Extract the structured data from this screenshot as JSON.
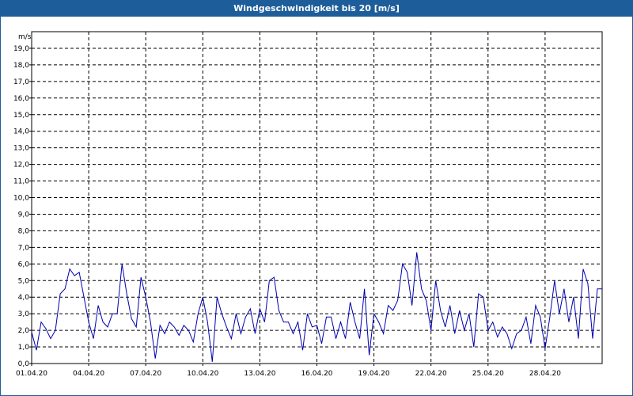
{
  "window": {
    "title": "Windgeschwindigkeit bis 20 [m/s]"
  },
  "chart_data": {
    "type": "line",
    "title": "Windgeschwindigkeit bis 20 [m/s]",
    "ylabel": "m/s",
    "xlabel": "",
    "ylim": [
      0,
      20
    ],
    "xlim": [
      "2020-04-01",
      "2020-05-01"
    ],
    "grid": true,
    "line_color": "#0000b0",
    "y_ticks": [
      "0,0",
      "1,0",
      "2,0",
      "3,0",
      "4,0",
      "5,0",
      "6,0",
      "7,0",
      "8,0",
      "9,0",
      "10,0",
      "11,0",
      "12,0",
      "13,0",
      "14,0",
      "15,0",
      "16,0",
      "17,0",
      "18,0",
      "19,0"
    ],
    "x_ticks": [
      "01.04.20",
      "04.04.20",
      "07.04.20",
      "10.04.20",
      "13.04.20",
      "16.04.20",
      "19.04.20",
      "22.04.20",
      "25.04.20",
      "28.04.20"
    ],
    "series": [
      {
        "x": [
          "2020-04-01T00:00",
          "2020-04-01T06:00",
          "2020-04-01T12:00",
          "2020-04-01T18:00",
          "2020-04-02T00:00",
          "2020-04-02T06:00",
          "2020-04-02T12:00",
          "2020-04-02T18:00",
          "2020-04-03T00:00",
          "2020-04-03T06:00",
          "2020-04-03T12:00",
          "2020-04-03T18:00",
          "2020-04-04T00:00",
          "2020-04-04T06:00",
          "2020-04-04T12:00",
          "2020-04-04T18:00",
          "2020-04-05T00:00",
          "2020-04-05T06:00",
          "2020-04-05T12:00",
          "2020-04-05T18:00",
          "2020-04-06T00:00",
          "2020-04-06T06:00",
          "2020-04-06T12:00",
          "2020-04-06T18:00",
          "2020-04-07T00:00",
          "2020-04-07T06:00",
          "2020-04-07T12:00",
          "2020-04-07T18:00",
          "2020-04-08T00:00",
          "2020-04-08T06:00",
          "2020-04-08T12:00",
          "2020-04-08T18:00",
          "2020-04-09T00:00",
          "2020-04-09T06:00",
          "2020-04-09T12:00",
          "2020-04-09T18:00",
          "2020-04-10T00:00",
          "2020-04-10T06:00",
          "2020-04-10T12:00",
          "2020-04-10T18:00",
          "2020-04-11T00:00",
          "2020-04-11T06:00",
          "2020-04-11T12:00",
          "2020-04-11T18:00",
          "2020-04-12T00:00",
          "2020-04-12T06:00",
          "2020-04-12T12:00",
          "2020-04-12T18:00",
          "2020-04-13T00:00",
          "2020-04-13T06:00",
          "2020-04-13T12:00",
          "2020-04-13T18:00",
          "2020-04-14T00:00",
          "2020-04-14T06:00",
          "2020-04-14T12:00",
          "2020-04-14T18:00",
          "2020-04-15T00:00",
          "2020-04-15T06:00",
          "2020-04-15T12:00",
          "2020-04-15T18:00",
          "2020-04-16T00:00",
          "2020-04-16T06:00",
          "2020-04-16T12:00",
          "2020-04-16T18:00",
          "2020-04-17T00:00",
          "2020-04-17T06:00",
          "2020-04-17T12:00",
          "2020-04-17T18:00",
          "2020-04-18T00:00",
          "2020-04-18T06:00",
          "2020-04-18T12:00",
          "2020-04-18T18:00",
          "2020-04-19T00:00",
          "2020-04-19T06:00",
          "2020-04-19T12:00",
          "2020-04-19T18:00",
          "2020-04-20T00:00",
          "2020-04-20T06:00",
          "2020-04-20T12:00",
          "2020-04-20T18:00",
          "2020-04-21T00:00",
          "2020-04-21T06:00",
          "2020-04-21T12:00",
          "2020-04-21T18:00",
          "2020-04-22T00:00",
          "2020-04-22T06:00",
          "2020-04-22T12:00",
          "2020-04-22T18:00",
          "2020-04-23T00:00",
          "2020-04-23T06:00",
          "2020-04-23T12:00",
          "2020-04-23T18:00",
          "2020-04-24T00:00",
          "2020-04-24T06:00",
          "2020-04-24T12:00",
          "2020-04-24T18:00",
          "2020-04-25T00:00",
          "2020-04-25T06:00",
          "2020-04-25T12:00",
          "2020-04-25T18:00",
          "2020-04-26T00:00",
          "2020-04-26T06:00",
          "2020-04-26T12:00",
          "2020-04-26T18:00",
          "2020-04-27T00:00",
          "2020-04-27T06:00",
          "2020-04-27T12:00",
          "2020-04-27T18:00",
          "2020-04-28T00:00",
          "2020-04-28T06:00",
          "2020-04-28T12:00",
          "2020-04-28T18:00",
          "2020-04-29T00:00",
          "2020-04-29T06:00",
          "2020-04-29T12:00",
          "2020-04-29T18:00",
          "2020-04-30T00:00",
          "2020-04-30T06:00",
          "2020-04-30T12:00",
          "2020-04-30T18:00",
          "2020-05-01T00:00"
        ],
        "y": [
          1.9,
          0.8,
          2.5,
          2.1,
          1.5,
          2.0,
          4.2,
          4.5,
          5.7,
          5.3,
          5.5,
          4.0,
          2.5,
          1.5,
          3.5,
          2.5,
          2.2,
          3.0,
          3.0,
          6.0,
          4.2,
          2.7,
          2.2,
          5.2,
          4.0,
          2.5,
          0.3,
          2.3,
          1.8,
          2.5,
          2.2,
          1.7,
          2.3,
          2.0,
          1.3,
          3.0,
          4.0,
          2.5,
          0.1,
          4.0,
          3.0,
          2.2,
          1.5,
          3.0,
          1.8,
          2.8,
          3.3,
          1.8,
          3.3,
          2.5,
          5.0,
          5.2,
          3.2,
          2.5,
          2.5,
          1.8,
          2.5,
          0.8,
          3.0,
          2.2,
          2.3,
          1.2,
          2.8,
          2.8,
          1.5,
          2.5,
          1.5,
          3.7,
          2.5,
          1.5,
          4.5,
          0.5,
          3.0,
          2.5,
          1.8,
          3.5,
          3.2,
          3.8,
          6.0,
          5.5,
          3.5,
          6.7,
          4.5,
          3.8,
          2.0,
          5.0,
          3.2,
          2.2,
          3.5,
          1.8,
          3.2,
          2.0,
          3.0,
          1.0,
          4.2,
          4.0,
          2.0,
          2.5,
          1.6,
          2.2,
          1.8,
          0.9,
          1.8,
          2.0,
          2.8,
          1.2,
          3.5,
          2.8,
          0.9,
          2.8,
          5.0,
          3.0,
          4.5,
          2.5,
          4.0,
          1.5,
          5.7,
          4.8,
          1.5,
          4.5,
          4.5
        ]
      }
    ]
  }
}
